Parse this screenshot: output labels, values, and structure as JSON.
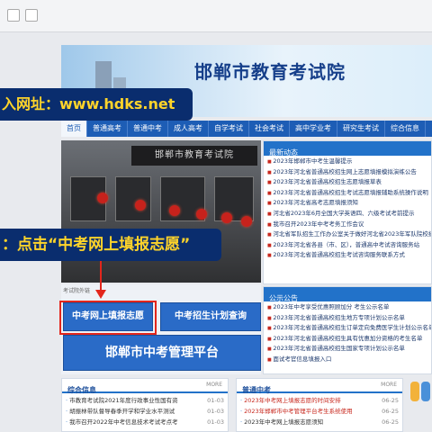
{
  "banner": {
    "title": "邯郸市教育考试院"
  },
  "callouts": {
    "url": "入网址：www.hdks.net",
    "instruction": "：点击“中考网上填报志愿”"
  },
  "nav": {
    "items": [
      "首页",
      "普通高考",
      "普通中考",
      "成人高考",
      "自学考试",
      "社会考试",
      "高中学业考",
      "研究生考试",
      "综合信息"
    ]
  },
  "photo": {
    "sign": "邯郸市教育考试院"
  },
  "news": {
    "title": "最新动态",
    "items": [
      "2023年邯郸市中考生温馨提示",
      "2023年河北省普通高校招生网上志愿填报模拟演练公告",
      "2023年河北省普通高校招生志愿填报草表",
      "2023年河北省普通高校招生考试志愿填报辅助系统操作说明",
      "2023年河北省高考志愿填报须知",
      "河北省2023年6月全国大学英语四、六级考试考前提示",
      "我市召开2023年中考考务工作会议",
      "河北省军队招生工作办公室关于做好河北省2023年军队院校招生",
      "2023年河北省各县（市、区），普通高中考试咨询服务站",
      "2023年河北省普通高校招生考试咨询服务联系方式"
    ]
  },
  "notice": {
    "title": "公示公告",
    "items": [
      "2023年中考享受优惠照顾加分 考生公示名单",
      "2023年河北省普通高校招生地方专项计划公示名单",
      "2023年河北省普通高校招生订单定向免费医学生计划公示名单",
      "2023年河北省普通高校招生具有优惠加分资格的考生名单",
      "2023年河北省普通高校招生国家专项计划公示名单",
      "面试考官信息填报入口"
    ]
  },
  "buttons": {
    "label": "考试院外链",
    "fill_volunteer": "中考网上填报志愿",
    "enrollment_plan": "中考招生计划查询",
    "platform": "邯郸市中考管理平台"
  },
  "panels": {
    "general": {
      "title": "综合信息",
      "more": "MORE",
      "items": [
        {
          "text": "市教育考试院2021年度行政事业性国有资",
          "date": "01-03"
        },
        {
          "text": "胡振林带队督导春季开学和学业水平测试",
          "date": "01-03"
        },
        {
          "text": "我市召开2022年中考信息技术考试考点考",
          "date": "01-03"
        }
      ]
    },
    "zhongkao": {
      "title": "普通中考",
      "more": "MORE",
      "items": [
        {
          "text": "2023年中考网上填报志愿的时间安排",
          "date": "06-25"
        },
        {
          "text": "2023年邯郸市中考管理平台考生系统使用",
          "date": "06-25"
        },
        {
          "text": "2023年中考网上填报志愿须知",
          "date": "06-25"
        }
      ]
    }
  },
  "colors": {
    "accent": "#1d5db5",
    "highlight": "#e3261c",
    "callout_text": "#ffd42a",
    "callout_bg": "#0a2d6e"
  }
}
